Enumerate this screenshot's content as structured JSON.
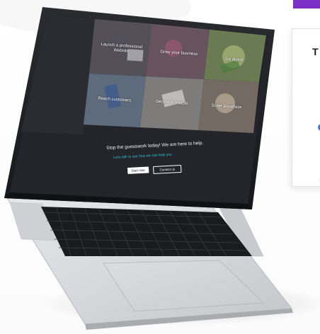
{
  "page": {
    "side_card_title": "T"
  },
  "screen": {
    "tiles": [
      {
        "label": "Launch a professional Website"
      },
      {
        "label": "Grow your business"
      },
      {
        "label": "Go digital"
      },
      {
        "label": "Reach customers"
      },
      {
        "label": "Secure & reliable"
      },
      {
        "label": "Scale anywhere"
      }
    ],
    "cta_text": "Stop the guesswork today! We are here to help.",
    "cta_link": "Let's talk to see how we can help you",
    "primary_button": "Start now",
    "secondary_button": "Contact us"
  },
  "colors": {
    "accent": "#7b2fc8",
    "link": "#2ec4d6",
    "screen_bg": "#23252b"
  }
}
